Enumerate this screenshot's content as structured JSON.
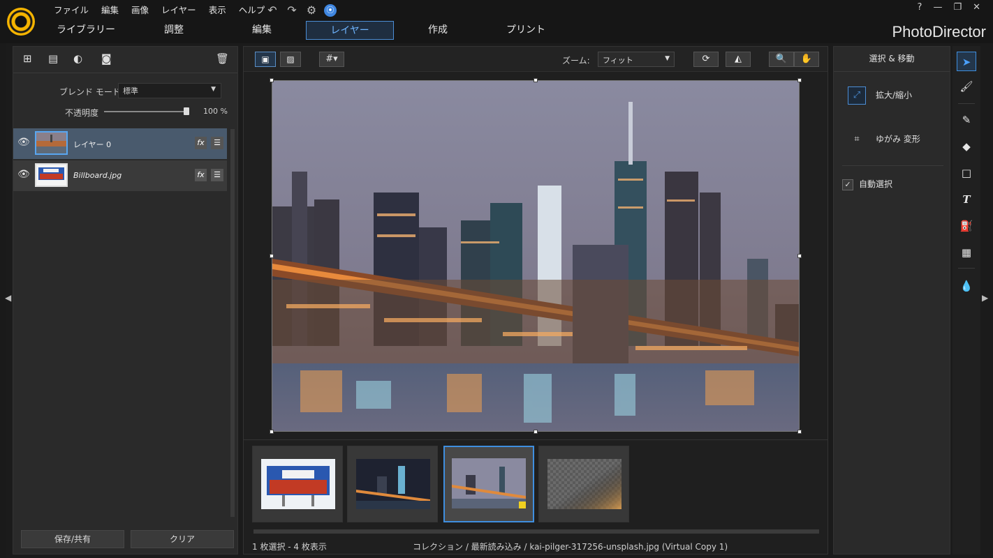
{
  "menu": [
    "ファイル",
    "編集",
    "画像",
    "レイヤー",
    "表示",
    "ヘルプ"
  ],
  "quick_icons": [
    "↶",
    "↷",
    "⚙",
    "🔔"
  ],
  "window_controls": [
    "?",
    "—",
    "❐",
    "✕"
  ],
  "tabs": [
    "ライブラリー",
    "調整",
    "編集",
    "レイヤー",
    "作成",
    "プリント"
  ],
  "brand": "PhotoDirector",
  "left_panel": {
    "blend_label": "ブレンド モード:",
    "blend_value": "標準",
    "opacity_label": "不透明度",
    "opacity_value": "100 %",
    "layers": [
      {
        "name": "レイヤー 0"
      },
      {
        "name": "Billboard.jpg"
      }
    ],
    "save_button": "保存/共有",
    "clear_button": "クリア"
  },
  "center": {
    "zoom_label": "ズーム:",
    "zoom_value": "フィット",
    "status_count": "1 枚選択 - 4 枚表示",
    "status_path": "コレクション / 最新読み込み / kai-pilger-317256-unsplash.jpg (Virtual Copy 1)"
  },
  "right_panel": {
    "title": "選択 & 移動",
    "scale_label": "拡大/縮小",
    "warp_label": "ゆがみ 変形",
    "auto_select_label": "自動選択"
  },
  "colors": {
    "accent": "#3f8fe0",
    "selected_layer": "#495a6d",
    "logo_yellow": "#f5b400"
  }
}
